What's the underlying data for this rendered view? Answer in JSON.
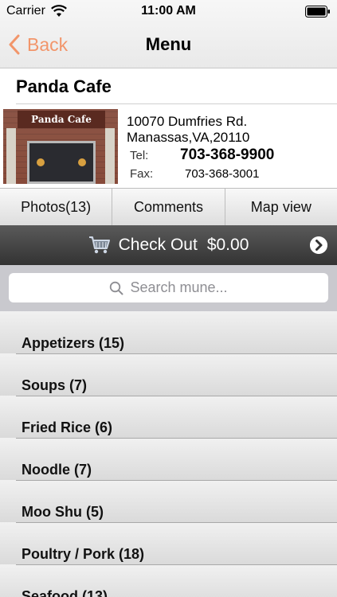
{
  "status_bar": {
    "carrier": "Carrier",
    "time": "11:00 AM"
  },
  "nav": {
    "back_label": "Back",
    "title": "Menu"
  },
  "restaurant": {
    "name": "Panda Cafe",
    "photo_sign": "Panda Cafe",
    "address_line1": "10070 Dumfries Rd.",
    "address_line2": "Manassas,VA,20110",
    "tel_label": "Tel:",
    "tel": "703-368-9900",
    "fax_label": "Fax:",
    "fax": "703-368-3001"
  },
  "tabs": [
    {
      "label": "Photos(13)"
    },
    {
      "label": "Comments"
    },
    {
      "label": "Map view"
    }
  ],
  "checkout": {
    "label": "Check Out",
    "total": "$0.00"
  },
  "search": {
    "placeholder": "Search mune..."
  },
  "categories": [
    {
      "label": "Appetizers (15)"
    },
    {
      "label": "Soups (7)"
    },
    {
      "label": "Fried Rice (6)"
    },
    {
      "label": "Noodle (7)"
    },
    {
      "label": "Moo Shu (5)"
    },
    {
      "label": "Poultry / Pork (18)"
    },
    {
      "label": "Seafood (13)"
    }
  ],
  "colors": {
    "accent": "#f2956a",
    "checkout_bar": "#3c3c3c",
    "search_bg": "#c9c9ce"
  },
  "icons": [
    "wifi-icon",
    "battery-icon",
    "back-chevron-icon",
    "cart-icon",
    "search-icon",
    "chevron-right-icon"
  ]
}
